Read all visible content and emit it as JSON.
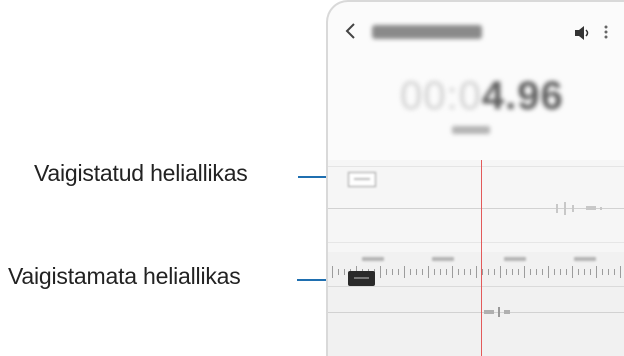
{
  "callouts": {
    "muted_source": "Vaigistatud heliallikas",
    "unmuted_source": "Vaigistamata heliallikas"
  },
  "phone": {
    "back_icon": "back-chevron-icon",
    "volume_icon": "speaker-icon",
    "more_icon": "more-vert-icon",
    "time_bold": "4.96"
  },
  "colors": {
    "callout_line": "#1f6fb0",
    "playhead": "#e35a5a"
  }
}
